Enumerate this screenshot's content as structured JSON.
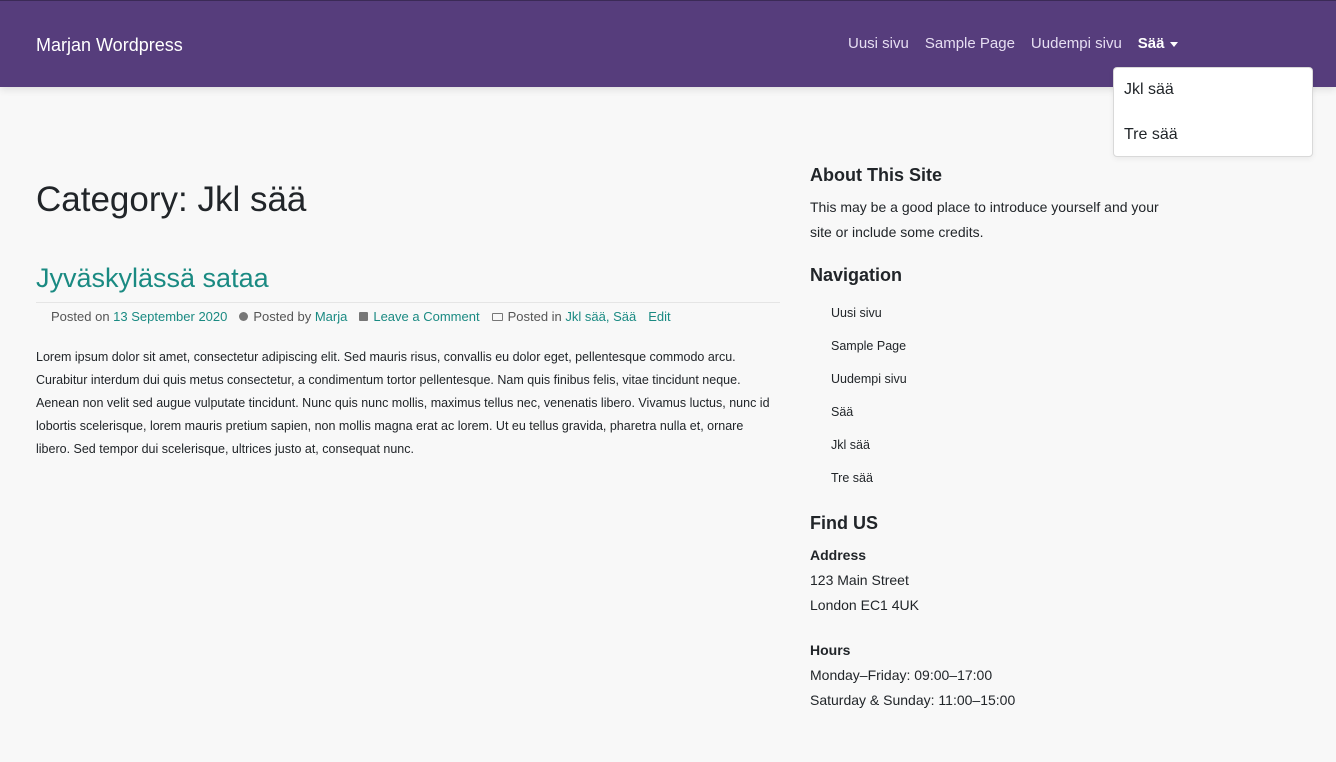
{
  "header": {
    "brand": "Marjan Wordpress",
    "nav": [
      "Uusi sivu",
      "Sample Page",
      "Uudempi sivu"
    ],
    "active_menu": "Sää",
    "dropdown": [
      "Jkl sää",
      "Tre sää"
    ]
  },
  "main": {
    "archive_title": "Category: Jkl sää",
    "post": {
      "title": "Jyväskylässä sataa",
      "posted_on_label": "Posted on",
      "date": "13 September 2020",
      "posted_by_label": "Posted by",
      "author": "Marja",
      "comment_link": "Leave a Comment",
      "posted_in_label": "Posted in",
      "categories": "Jkl sää, Sää",
      "edit": "Edit",
      "body": "Lorem ipsum dolor sit amet, consectetur adipiscing elit. Sed mauris risus, convallis eu dolor eget, pellentesque commodo arcu. Curabitur interdum dui quis metus consectetur, a condimentum tortor pellentesque. Nam quis finibus felis, vitae tincidunt neque. Aenean non velit sed augue vulputate tincidunt. Nunc quis nunc mollis, maximus tellus nec, venenatis libero. Vivamus luctus, nunc id lobortis scelerisque, lorem mauris pretium sapien, non mollis magna erat ac lorem. Ut eu tellus gravida, pharetra nulla et, ornare libero. Sed tempor dui scelerisque, ultrices justo at, consequat nunc."
    }
  },
  "sidebar": {
    "about": {
      "title": "About This Site",
      "text": "This may be a good place to introduce yourself and your site or include some credits."
    },
    "navigation": {
      "title": "Navigation",
      "items": [
        "Uusi sivu",
        "Sample Page",
        "Uudempi sivu",
        "Sää",
        "Jkl sää",
        "Tre sää"
      ]
    },
    "find": {
      "title": "Find US",
      "address_label": "Address",
      "address_line1": "123 Main Street",
      "address_line2": "London EC1 4UK",
      "hours_label": "Hours",
      "hours_line1": "Monday–Friday: 09:00–17:00",
      "hours_line2": "Saturday & Sunday: 11:00–15:00"
    }
  },
  "colors": {
    "header_bg": "#563d7c",
    "link": "#1a8a82",
    "page_bg": "#f8f8f8"
  }
}
